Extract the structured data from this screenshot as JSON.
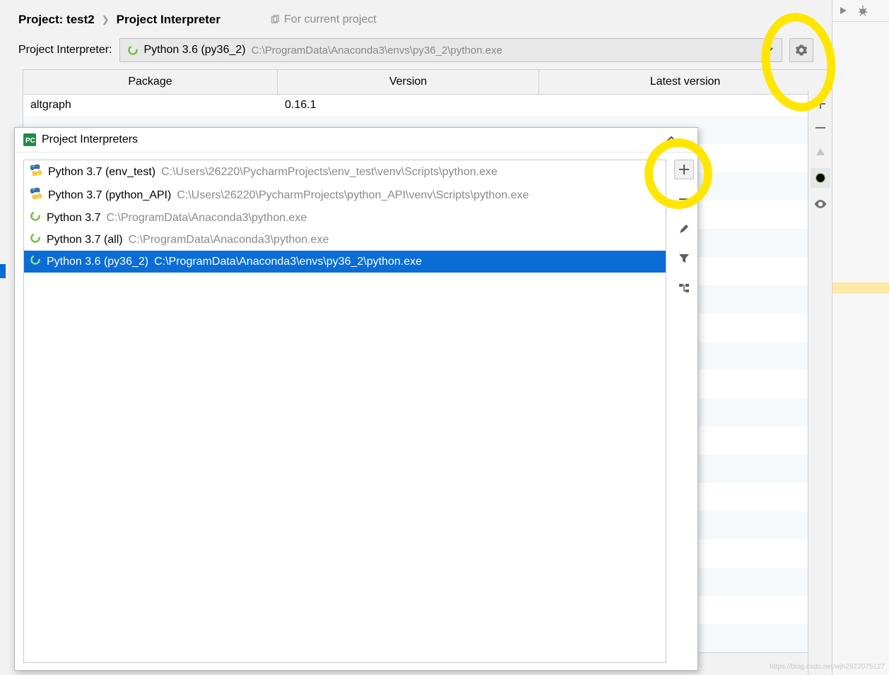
{
  "breadcrumb": {
    "project_prefix": "Project:",
    "project_name": "test2",
    "page": "Project Interpreter",
    "current_project_label": "For current project"
  },
  "interpreter_row": {
    "label": "Project Interpreter:",
    "selected_name": "Python 3.6 (py36_2)",
    "selected_path": "C:\\ProgramData\\Anaconda3\\envs\\py36_2\\python.exe"
  },
  "packages_table": {
    "headers": {
      "c1": "Package",
      "c2": "Version",
      "c3": "Latest version"
    },
    "rows": [
      {
        "package": "altgraph",
        "version": "0.16.1",
        "latest": ""
      }
    ]
  },
  "popup": {
    "title": "Project Interpreters",
    "items": [
      {
        "icon": "python",
        "name": "Python 3.7 (env_test)",
        "path": "C:\\Users\\26220\\PycharmProjects\\env_test\\venv\\Scripts\\python.exe",
        "selected": false
      },
      {
        "icon": "python",
        "name": "Python 3.7 (python_API)",
        "path": "C:\\Users\\26220\\PycharmProjects\\python_API\\venv\\Scripts\\python.exe",
        "selected": false
      },
      {
        "icon": "spinner",
        "name": "Python 3.7",
        "path": "C:\\ProgramData\\Anaconda3\\python.exe",
        "selected": false
      },
      {
        "icon": "spinner",
        "name": "Python 3.7 (all)",
        "path": "C:\\ProgramData\\Anaconda3\\python.exe",
        "selected": false
      },
      {
        "icon": "spinner",
        "name": "Python 3.6 (py36_2)",
        "path": "C:\\ProgramData\\Anaconda3\\envs\\py36_2\\python.exe",
        "selected": true
      }
    ],
    "side_buttons": {
      "add": "+",
      "remove": "−",
      "edit": "edit",
      "filter": "filter",
      "tree": "tree"
    }
  },
  "side_tools": {
    "add": "+",
    "remove": "−",
    "up": "▲",
    "spinner": "loading",
    "show": "show-paths"
  },
  "watermark": "https://blog.csdn.net/wjh2622075127"
}
